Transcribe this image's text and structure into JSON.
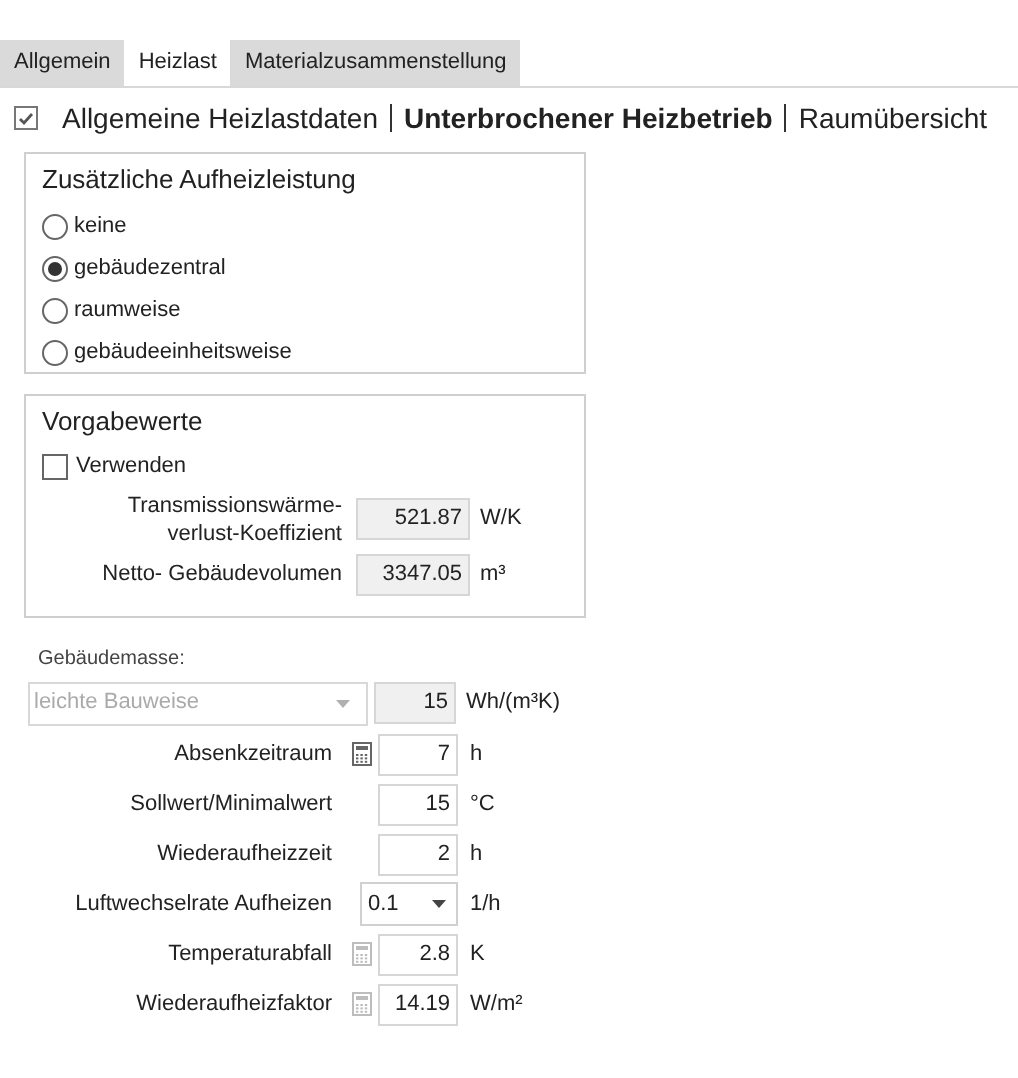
{
  "tabs": [
    {
      "label": "Allgemein",
      "selected": false
    },
    {
      "label": "Heizlast",
      "selected": true
    },
    {
      "label": "Materialzusammenstellung",
      "selected": false
    }
  ],
  "breadcrumb": {
    "checked": true,
    "items": [
      {
        "label": "Allgemeine Heizlastdaten",
        "selected": false
      },
      {
        "label": "Unterbrochener Heizbetrieb",
        "selected": true
      },
      {
        "label": "Raumübersicht",
        "selected": false
      }
    ]
  },
  "aufheiz_group": {
    "title": "Zusätzliche Aufheizleistung",
    "options": [
      {
        "label": "keine",
        "selected": false
      },
      {
        "label": "gebäudezentral",
        "selected": true
      },
      {
        "label": "raumweise",
        "selected": false
      },
      {
        "label": "gebäudeeinheitsweise",
        "selected": false
      }
    ]
  },
  "vorgabe_group": {
    "title": "Vorgabewerte",
    "use": {
      "label": "Verwenden",
      "checked": false
    },
    "fields": [
      {
        "label": "Transmissionswärme-\nverlust-Koeffizient",
        "value": "521.87",
        "unit": "W/K"
      },
      {
        "label": "Netto- Gebäudevolumen",
        "value": "3347.05",
        "unit": "m³"
      }
    ]
  },
  "gebaeudemasse": {
    "label": "Gebäudemasse:",
    "selection": "leichte Bauweise",
    "disabled": true,
    "value": "15",
    "unit": "Wh/(m³K)"
  },
  "rows": [
    {
      "label": "Absenkzeitraum",
      "kind": "input",
      "calculator": true,
      "calculator_dimmed": false,
      "value": "7",
      "unit": "h"
    },
    {
      "label": "Sollwert/Minimalwert",
      "kind": "input",
      "value": "15",
      "unit": "°C"
    },
    {
      "label": "Wiederaufheizzeit",
      "kind": "input",
      "value": "2",
      "unit": "h"
    },
    {
      "label": "Luftwechselrate Aufheizen",
      "kind": "dropdown",
      "value": "0.1",
      "unit": "1/h"
    },
    {
      "label": "Temperaturabfall",
      "kind": "input",
      "calculator": true,
      "calculator_dimmed": true,
      "value": "2.8",
      "unit": "K"
    },
    {
      "label": "Wiederaufheizfaktor",
      "kind": "input",
      "calculator": true,
      "calculator_dimmed": true,
      "value": "14.19",
      "unit": "W/m²"
    }
  ]
}
